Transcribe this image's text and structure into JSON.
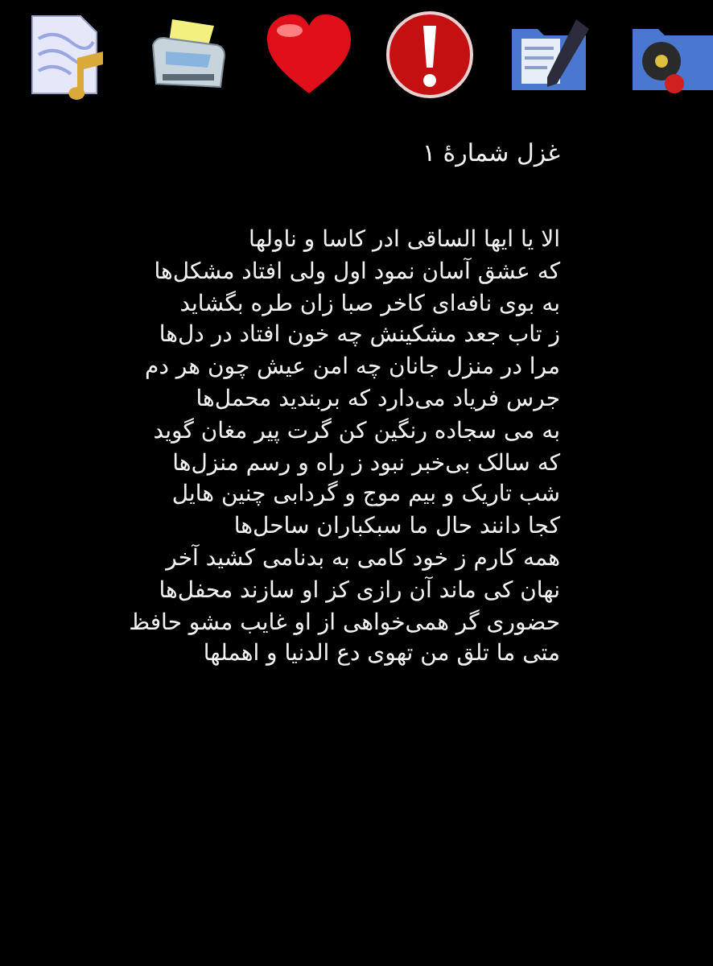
{
  "title": "غزل شمارهٔ ۱",
  "verses": [
    "الا یا ایها الساقی ادر کاسا و ناولها",
    "که عشق آسان نمود اول ولی افتاد مشکل‌ها",
    "به بوی نافه‌ای کاخر صبا زان طره بگشاید",
    "ز تاب جعد مشکینش چه خون افتاد در دل‌ها",
    "مرا در منزل جانان چه امن عیش چون هر دم",
    "جرس فریاد می‌دارد که بربندید محمل‌ها",
    "به می سجاده رنگین کن گرت پیر مغان گوید",
    "که سالک بی‌خبر نبود ز راه و رسم منزل‌ها",
    "شب تاریک و بیم موج و گردابی چنین هایل",
    "کجا دانند حال ما سبکباران ساحل‌ها",
    "همه کارم ز خود کامی به بدنامی کشید آخر",
    "نهان کی ماند آن رازی کز او سازند محفل‌ها",
    "حضوری گر همی‌خواهی از او غایب مشو حافظ",
    "متی ما تلق من تهوی دع الدنیا و اهملها"
  ]
}
